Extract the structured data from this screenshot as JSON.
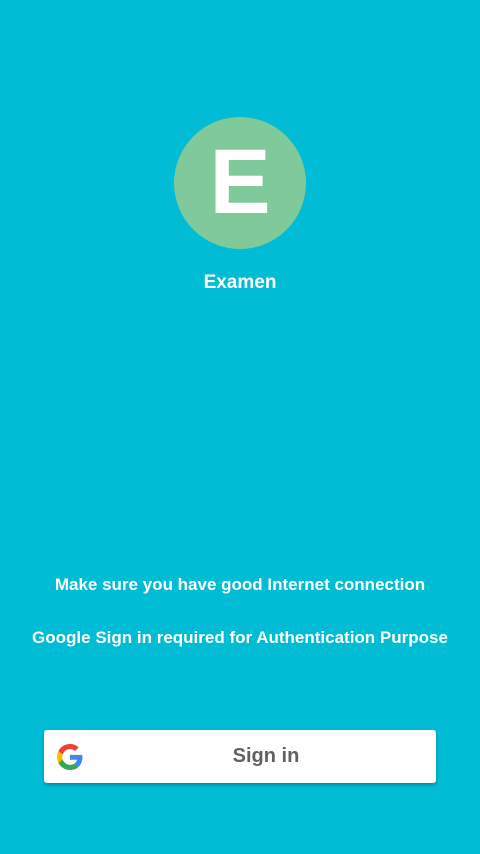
{
  "app": {
    "logo_letter": "E",
    "name": "Examen"
  },
  "notices": {
    "internet": "Make sure you have good Internet connection",
    "google": "Google Sign in required for Authentication Purpose"
  },
  "signin_button": {
    "label": "Sign in",
    "icon": "google-g-icon"
  },
  "colors": {
    "background": "#00bcd4",
    "logo_circle": "#7fc99a",
    "text": "#ffffff",
    "button_background": "#ffffff",
    "button_text": "#616161"
  }
}
